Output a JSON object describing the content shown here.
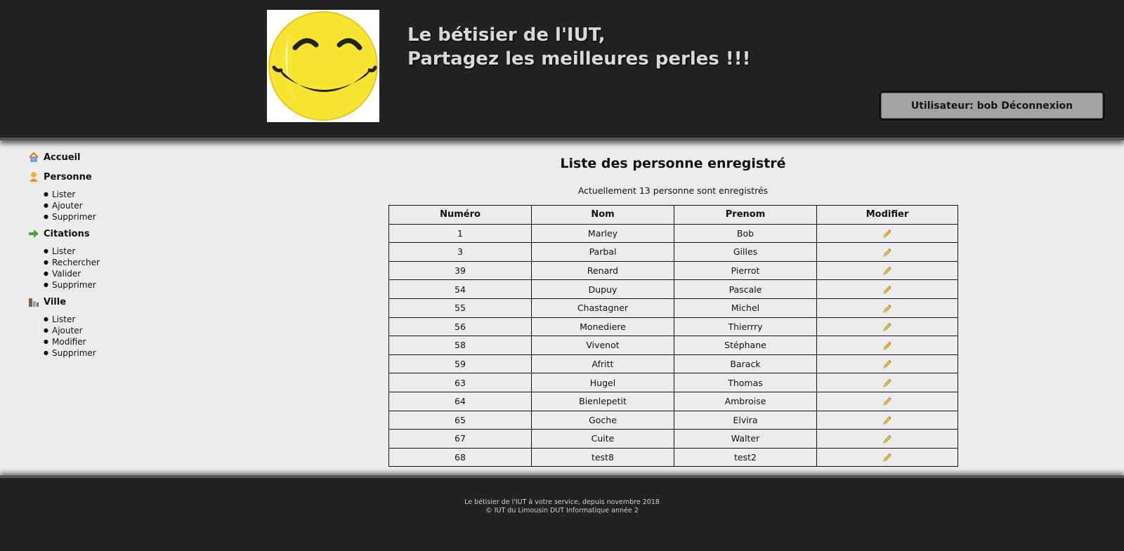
{
  "header": {
    "title_line1": "Le bétisier de l'IUT,",
    "title_line2": "Partagez les meilleures perles !!!",
    "user_label": "Utilisateur: bob",
    "logout_label": "Déconnexion"
  },
  "nav": {
    "sections": [
      {
        "label": "Accueil",
        "icon": "home-icon",
        "items": []
      },
      {
        "label": "Personne",
        "icon": "person-icon",
        "items": [
          "Lister",
          "Ajouter",
          "Supprimer"
        ]
      },
      {
        "label": "Citations",
        "icon": "arrow-right-icon",
        "items": [
          "Lister",
          "Rechercher",
          "Valider",
          "Supprimer"
        ]
      },
      {
        "label": "Ville",
        "icon": "city-icon",
        "items": [
          "Lister",
          "Ajouter",
          "Modifier",
          "Supprimer"
        ]
      }
    ]
  },
  "main": {
    "title": "Liste des personne enregistré",
    "count_text": "Actuellement 13 personne sont enregistrés",
    "table": {
      "headers": [
        "Numéro",
        "Nom",
        "Prenom",
        "Modifier"
      ],
      "rows": [
        [
          "1",
          "Marley",
          "Bob"
        ],
        [
          "3",
          "Parbal",
          "Gilles"
        ],
        [
          "39",
          "Renard",
          "Pierrot"
        ],
        [
          "54",
          "Dupuy",
          "Pascale"
        ],
        [
          "55",
          "Chastagner",
          "Michel"
        ],
        [
          "56",
          "Monediere",
          "Thierrry"
        ],
        [
          "58",
          "Vivenot",
          "Stéphane"
        ],
        [
          "59",
          "Afritt",
          "Barack"
        ],
        [
          "63",
          "Hugel",
          "Thomas"
        ],
        [
          "64",
          "Bienlepetit",
          "Ambroise"
        ],
        [
          "65",
          "Goche",
          "Elvira"
        ],
        [
          "67",
          "Cuite",
          "Walter"
        ],
        [
          "68",
          "test8",
          "test2"
        ]
      ],
      "edit_icon": "pencil-icon"
    }
  },
  "footer": {
    "line1": "Le bétisier de l'IUT à votre service, depuis novembre 2018",
    "line2": "© IUT du Limousin DUT Informatique année 2"
  },
  "colors": {
    "header_bg": "#222222",
    "page_bg": "#ececec",
    "user_box_bg": "#a3a3a3",
    "smiley_yellow": "#f7e531"
  }
}
